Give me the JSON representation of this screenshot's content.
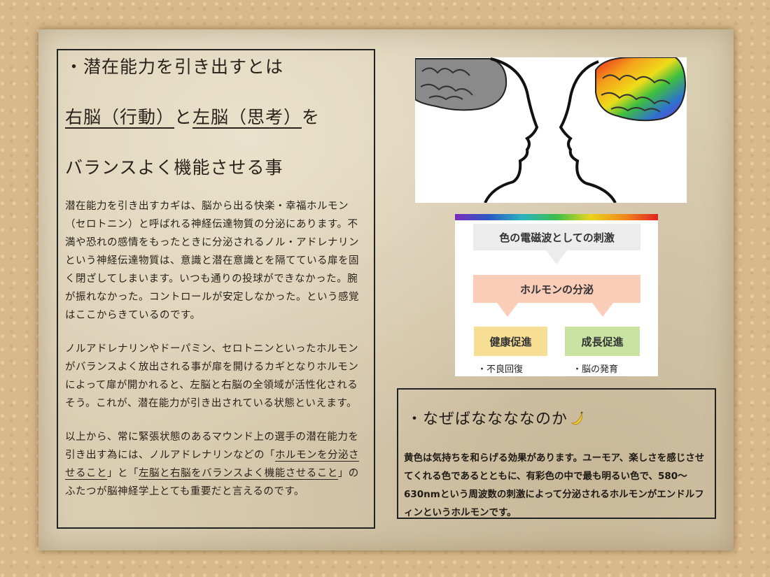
{
  "left": {
    "heading_line1": "・潜在能力を引き出すとは",
    "heading_right_brain": "右脳（行動）",
    "heading_to": "と",
    "heading_left_brain": "左脳（思考）",
    "heading_wo": "を",
    "heading_line3": "バランスよく機能させる事",
    "para1": "潜在能力を引き出すカギは、脳から出る快楽・幸福ホルモン（セロトニン）と呼ばれる神経伝達物質の分泌にあります。不満や恐れの感情をもったときに分泌されるノル・アドレナリンという神経伝達物質は、意識と潜在意識とを隔てている扉を固く閉ざしてしまいます。いつも通りの投球ができなかった。腕が振れなかった。コントロールが安定しなかった。という感覚はここからきているのです。",
    "para2": "ノルアドレナリンやドーパミン、セロトニンといったホルモンがバランスよく放出される事が扉を開けるカギとなりホルモンによって扉が開かれると、左脳と右脳の全領域が活性化されるそう。これが、潜在能力が引き出されている状態といえます。",
    "para3_a": "以上から、常に緊張状態のあるマウンド上の選手の潜在能力を引き出す為には、ノルアドレナリンなどの「",
    "para3_u1": "ホルモンを分泌させること",
    "para3_b": "」と「",
    "para3_u2": "左脳と右脳をバランスよく機能させること",
    "para3_c": "」のふたつが脳神経学上とても重要だと言えるのです。"
  },
  "flow": {
    "step1": "色の電磁波としての刺激",
    "step2": "ホルモンの分泌",
    "step3a": "健康促進",
    "step3b": "成長促進",
    "sub_a": "・不良回復",
    "sub_b": "・脳の発育"
  },
  "right": {
    "title": "・なぜばななななのか",
    "body": "黄色は気持ちを和らげる効果があります。ユーモア、楽しさを感じさせてくれる色であるとともに、有彩色の中で最も明るい色で、580〜630nmという周波数の刺激によって分泌されるホルモンがエンドルフィンというホルモンです。"
  },
  "colors": {
    "paper": "#d9cdb2",
    "background": "#d8b98a",
    "grey_box": "#ececec",
    "pink_box": "#f9cdb8",
    "yellow_box": "#f7de95",
    "green_box": "#c8e3a2"
  },
  "icons": [
    "banana-icon",
    "brain-grey-icon",
    "brain-rainbow-icon"
  ]
}
